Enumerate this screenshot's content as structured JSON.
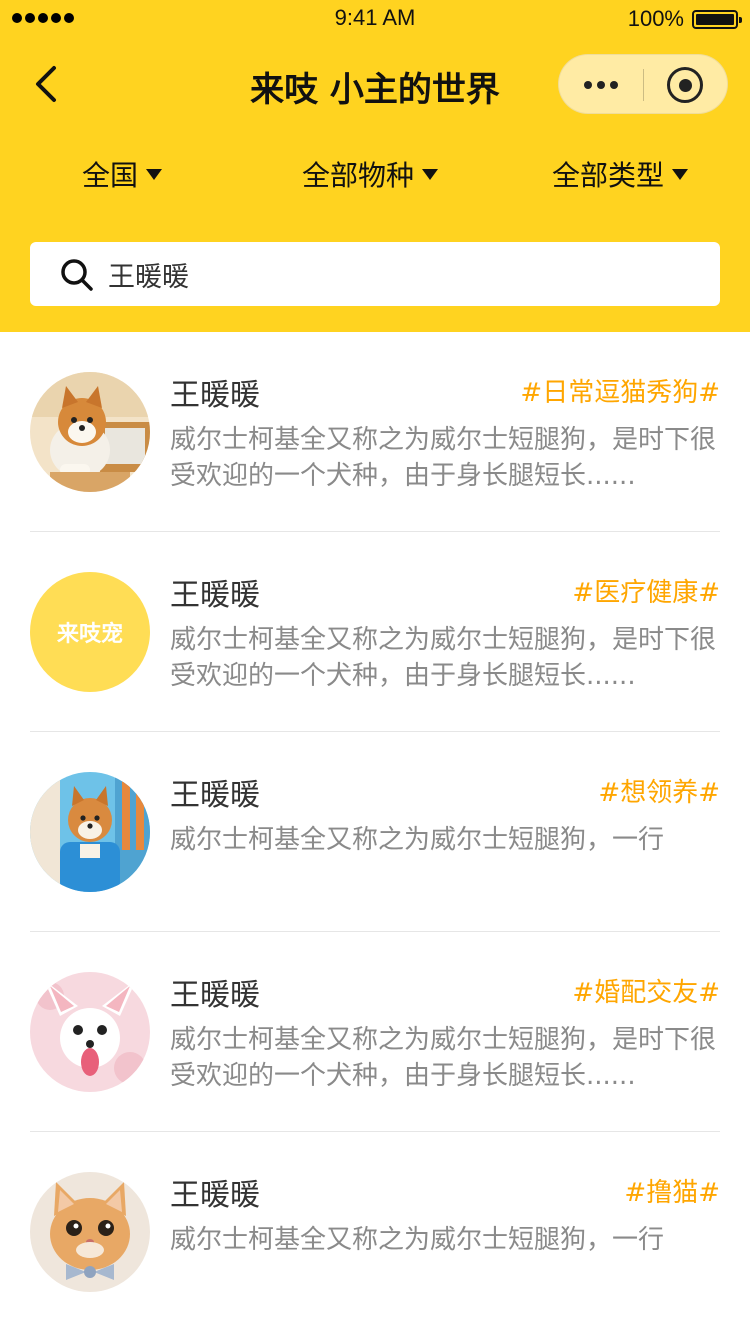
{
  "status_bar": {
    "time": "9:41 AM",
    "battery": "100%"
  },
  "nav": {
    "title": "来吱 小主的世界"
  },
  "filters": [
    {
      "label": "全国"
    },
    {
      "label": "全部物种"
    },
    {
      "label": "全部类型"
    }
  ],
  "search": {
    "value": "王暖暖"
  },
  "colors": {
    "brand_yellow": "#FFD320",
    "tag_orange": "#FFA600",
    "description_gray": "#8A8A8A"
  },
  "posts": [
    {
      "avatar": "shiba-puppy-photo",
      "name": "王暖暖",
      "tag": "#日常逗猫秀狗#",
      "description": "威尔士柯基全又称之为威尔士短腿狗，是时下很受欢迎的一个犬种，由于身长腿短长......"
    },
    {
      "avatar": "brand-logo",
      "avatar_text": "来吱宠",
      "name": "王暖暖",
      "tag": "#医疗健康#",
      "description": "威尔士柯基全又称之为威尔士短腿狗，是时下很受欢迎的一个犬种，由于身长腿短长......"
    },
    {
      "avatar": "shiba-blue-shirt-photo",
      "name": "王暖暖",
      "tag": "#想领养#",
      "description": "威尔士柯基全又称之为威尔士短腿狗，一行"
    },
    {
      "avatar": "chihuahua-photo",
      "name": "王暖暖",
      "tag": "#婚配交友#",
      "description": "威尔士柯基全又称之为威尔士短腿狗，是时下很受欢迎的一个犬种，由于身长腿短长......"
    },
    {
      "avatar": "orange-cat-bowtie-photo",
      "name": "王暖暖",
      "tag": "#撸猫#",
      "description": "威尔士柯基全又称之为威尔士短腿狗，一行"
    }
  ]
}
